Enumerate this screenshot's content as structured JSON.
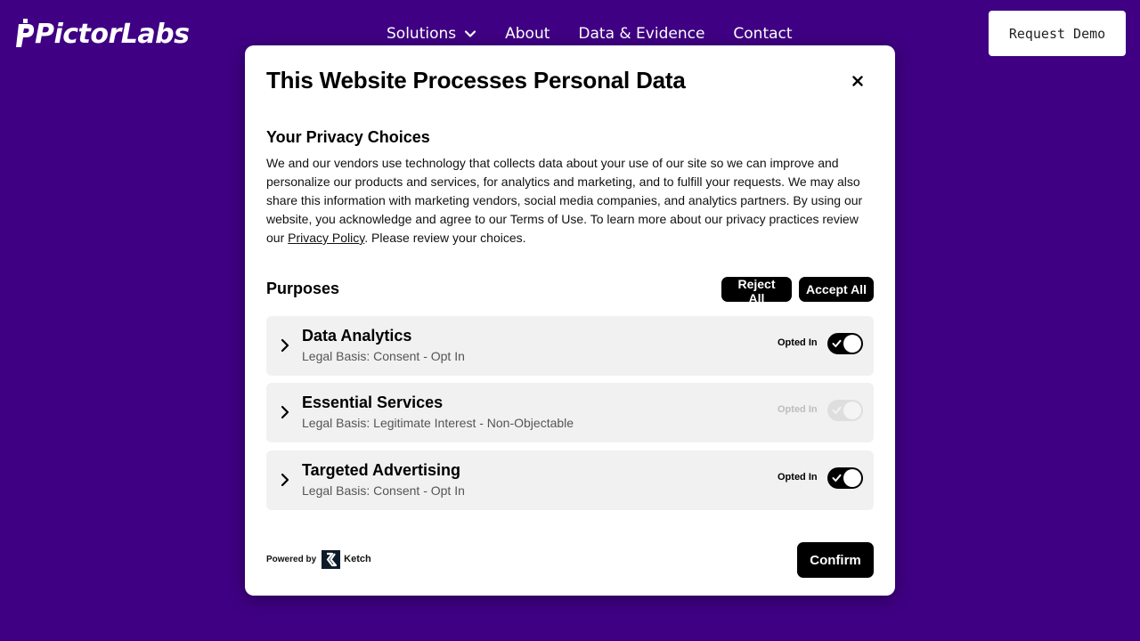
{
  "site": {
    "logo_text": "PictorLabs",
    "nav": [
      {
        "label": "Solutions",
        "has_dropdown": true
      },
      {
        "label": "About"
      },
      {
        "label": "Data & Evidence"
      },
      {
        "label": "Contact"
      }
    ],
    "request_demo_label": "Request Demo"
  },
  "modal": {
    "title": "This Website Processes Personal Data",
    "close_icon": "close-icon",
    "privacy_heading": "Your Privacy Choices",
    "privacy_text_before_link": "We and our vendors use technology that collects data about your use of our site so we can improve and personalize our products and services, for analytics and marketing, and to fulfill your requests. We may also share this information with marketing vendors, social media companies, and analytics partners. By using our website, you acknowledge and agree to our Terms of Use. To learn more about our privacy practices review our ",
    "privacy_link_label": "Privacy Policy",
    "privacy_text_after_link": ". Please review your choices.",
    "purposes_heading": "Purposes",
    "reject_all_label": "Reject All",
    "accept_all_label": "Accept All",
    "purposes": [
      {
        "title": "Data Analytics",
        "legal_basis": "Legal Basis: Consent - Opt In",
        "status": "Opted In",
        "enabled": true,
        "disabled": false
      },
      {
        "title": "Essential Services",
        "legal_basis": "Legal Basis: Legitimate Interest - Non-Objectable",
        "status": "Opted In",
        "enabled": true,
        "disabled": true
      },
      {
        "title": "Targeted Advertising",
        "legal_basis": "Legal Basis: Consent - Opt In",
        "status": "Opted In",
        "enabled": true,
        "disabled": false
      }
    ],
    "powered_by_label": "Powered by",
    "ketch_name": "Ketch",
    "confirm_label": "Confirm"
  },
  "colors": {
    "page_background": "#3f0083",
    "modal_background": "#ffffff",
    "button_primary": "#000000",
    "row_background": "#f1f1f1"
  }
}
